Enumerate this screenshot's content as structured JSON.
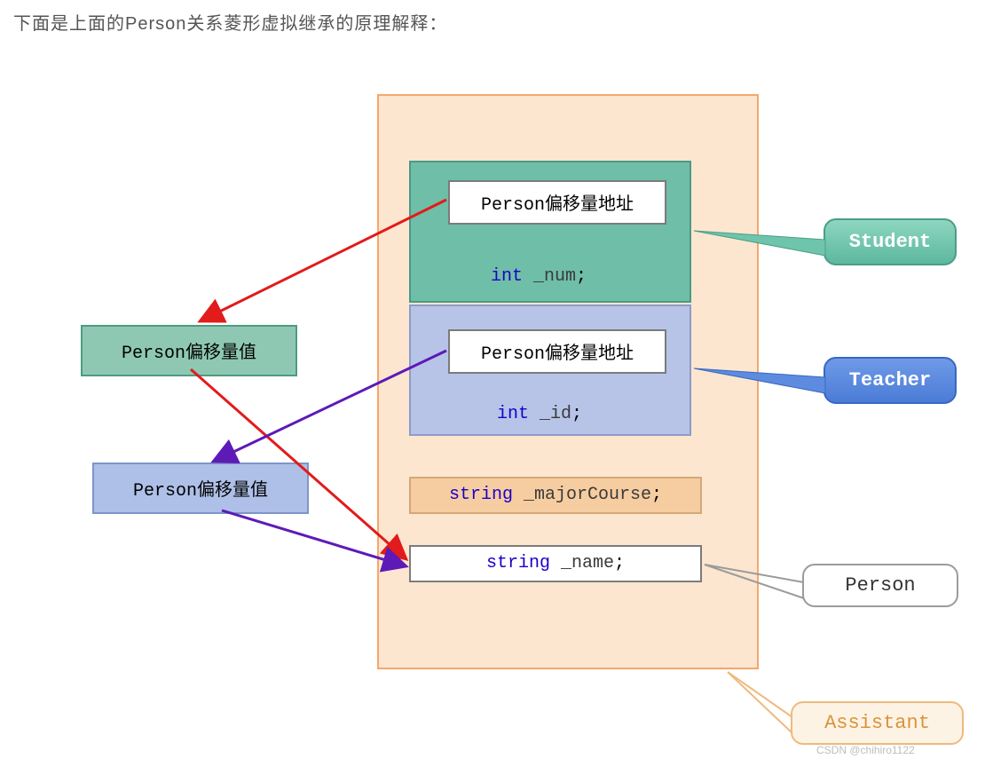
{
  "heading": "下面是上面的Person关系菱形虚拟继承的原理解释：",
  "student_block": {
    "addr_label": "Person偏移量地址",
    "field_type": "int",
    "field_name": " _num",
    "semicolon": ";"
  },
  "teacher_block": {
    "addr_label": "Person偏移量地址",
    "field_type": "int",
    "field_name": " _id",
    "semicolon": ";"
  },
  "major": {
    "type": "string",
    "name": " _majorCourse",
    "semicolon": ";"
  },
  "name_field": {
    "type": "string",
    "name": " _name",
    "semicolon": ";"
  },
  "offval1": "Person偏移量值",
  "offval2": "Person偏移量值",
  "callouts": {
    "student": "Student",
    "teacher": "Teacher",
    "person": "Person",
    "assistant": "Assistant"
  },
  "watermark": "CSDN @chihiro1122"
}
